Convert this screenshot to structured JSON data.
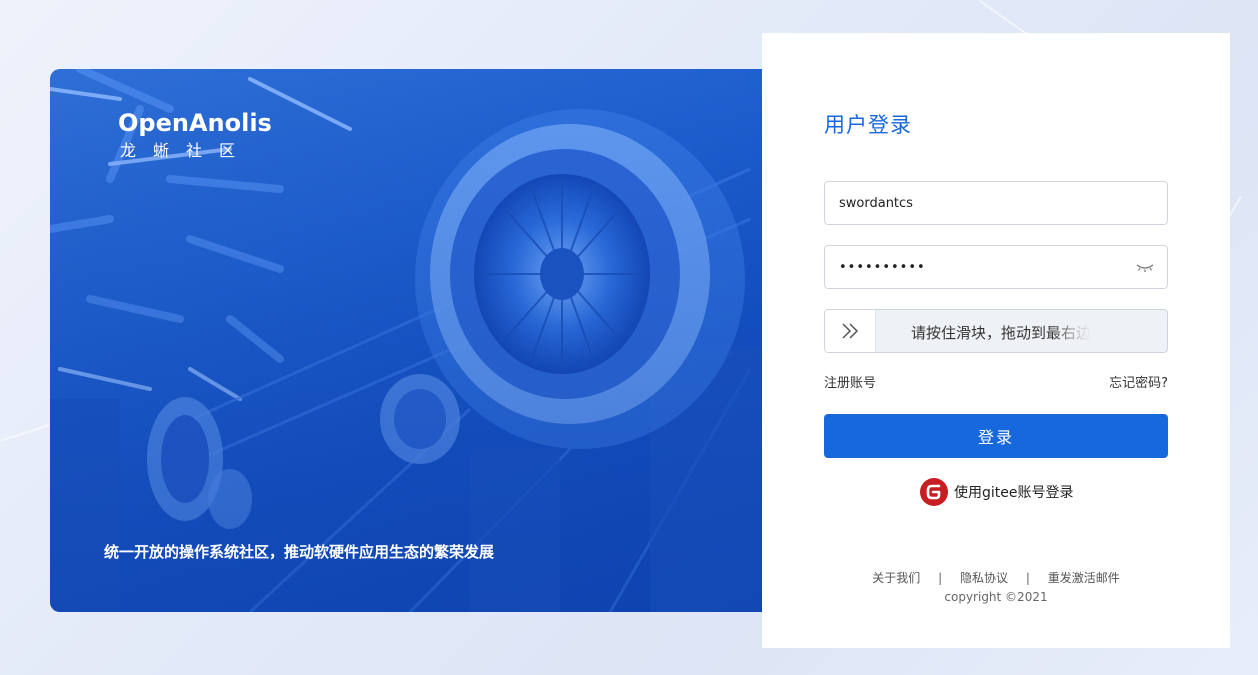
{
  "hero": {
    "logo_en": "OpenAnolis",
    "logo_cn": "龙蜥社区",
    "slogan": "统一开放的操作系统社区，推动软硬件应用生态的繁荣发展"
  },
  "login": {
    "title": "用户登录",
    "username_value": "swordantcs",
    "password_value": "••••••••••",
    "slider_text": "请按住滑块，拖动到最右边",
    "register_label": "注册账号",
    "forgot_label": "忘记密码?",
    "submit_label": "登录",
    "gitee_label": "使用gitee账号登录"
  },
  "footer": {
    "about": "关于我们",
    "privacy": "隐私协议",
    "resend": "重发激活邮件",
    "copyright": "copyright ©2021"
  },
  "icons": {
    "eye": "eye-closed-icon",
    "slider": "double-chevron-right-icon",
    "gitee": "gitee-logo-icon"
  },
  "colors": {
    "accent": "#1668dc",
    "gitee_red": "#c71d23"
  }
}
